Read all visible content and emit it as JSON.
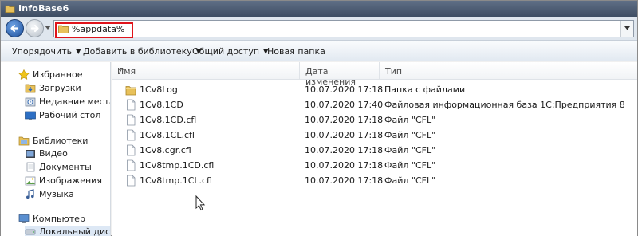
{
  "window": {
    "title": "InfoBase6"
  },
  "address": {
    "path": "%appdata%"
  },
  "toolbar": {
    "organize": "Упорядочить",
    "add_to_library": "Добавить в библиотеку",
    "share": "Общий доступ",
    "new_folder": "Новая папка"
  },
  "sidebar": {
    "favorites": "Избранное",
    "downloads": "Загрузки",
    "recent": "Недавние места",
    "desktop": "Рабочий стол",
    "libraries": "Библиотеки",
    "video": "Видео",
    "documents": "Документы",
    "images": "Изображения",
    "music": "Музыка",
    "computer": "Компьютер",
    "local_disk": "Локальный диск ("
  },
  "columns": {
    "name": "Имя",
    "date": "Дата изменения",
    "type": "Тип"
  },
  "files": [
    {
      "name": "1Cv8Log",
      "date": "10.07.2020 17:18",
      "type": "Папка с файлами",
      "icon": "folder-icon"
    },
    {
      "name": "1Cv8.1CD",
      "date": "10.07.2020 17:40",
      "type": "Файловая информационная база 1С:Предприятия 8",
      "icon": "file-icon"
    },
    {
      "name": "1Cv8.1CD.cfl",
      "date": "10.07.2020 17:18",
      "type": "Файл \"CFL\"",
      "icon": "file-icon"
    },
    {
      "name": "1Cv8.1CL.cfl",
      "date": "10.07.2020 17:18",
      "type": "Файл \"CFL\"",
      "icon": "file-icon"
    },
    {
      "name": "1Cv8.cgr.cfl",
      "date": "10.07.2020 17:18",
      "type": "Файл \"CFL\"",
      "icon": "file-icon"
    },
    {
      "name": "1Cv8tmp.1CD.cfl",
      "date": "10.07.2020 17:18",
      "type": "Файл \"CFL\"",
      "icon": "file-icon"
    },
    {
      "name": "1Cv8tmp.1CL.cfl",
      "date": "10.07.2020 17:18",
      "type": "Файл \"CFL\"",
      "icon": "file-icon"
    }
  ],
  "colors": {
    "highlight": "#e0141b",
    "titlebar": "#4a5a70",
    "folder": "#e8c15a"
  }
}
